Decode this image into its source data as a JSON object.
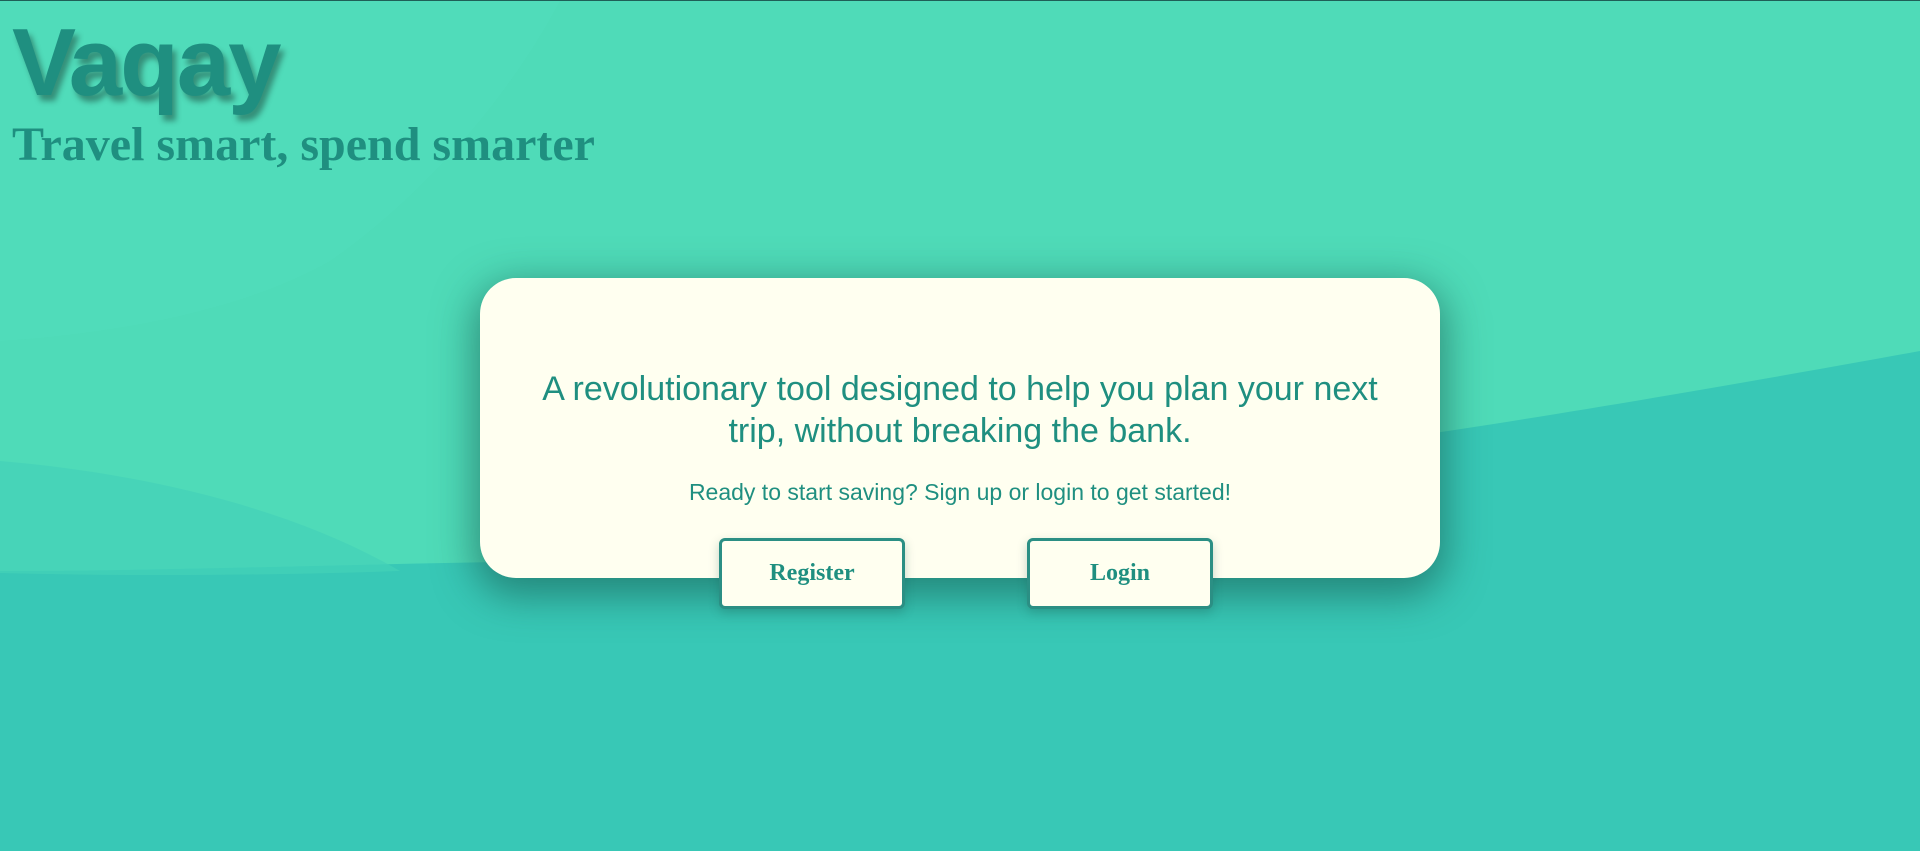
{
  "brand": {
    "logo": "Vaqay",
    "tagline": "Travel smart, spend smarter"
  },
  "hero": {
    "headline": "A revolutionary tool designed to help you plan your next trip, without breaking the bank.",
    "subtext": "Ready to start saving? Sign up or login to get started!"
  },
  "actions": {
    "register_label": "Register",
    "login_label": "Login"
  },
  "colors": {
    "background_top": "#4fdbb8",
    "background_bottom": "#38c8b6",
    "brand_text": "#1f8f80",
    "card_background": "#fffff0",
    "button_border": "#2b8f84"
  }
}
